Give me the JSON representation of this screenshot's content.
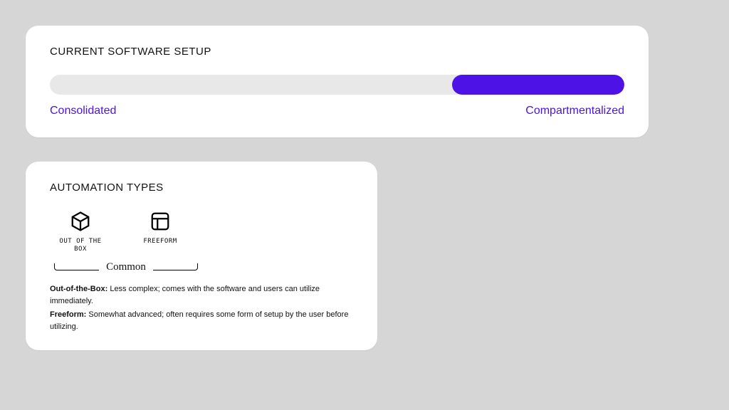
{
  "colors": {
    "accent": "#4d13e6"
  },
  "software_setup": {
    "title": "CURRENT SOFTWARE SETUP",
    "left_label": "Consolidated",
    "right_label": "Compartmentalized",
    "fill_percent": 30
  },
  "automation": {
    "title": "AUTOMATION TYPES",
    "types": [
      {
        "icon": "cube-icon",
        "label": "OUT OF THE BOX"
      },
      {
        "icon": "layout-icon",
        "label": "FREEFORM"
      }
    ],
    "group_label": "Common",
    "descriptions": [
      {
        "term": "Out-of-the-Box:",
        "text": " Less complex; comes with the software and users can utilize immediately."
      },
      {
        "term": "Freeform:",
        "text": " Somewhat advanced; often requires some form of setup by the user before utilizing."
      }
    ]
  }
}
